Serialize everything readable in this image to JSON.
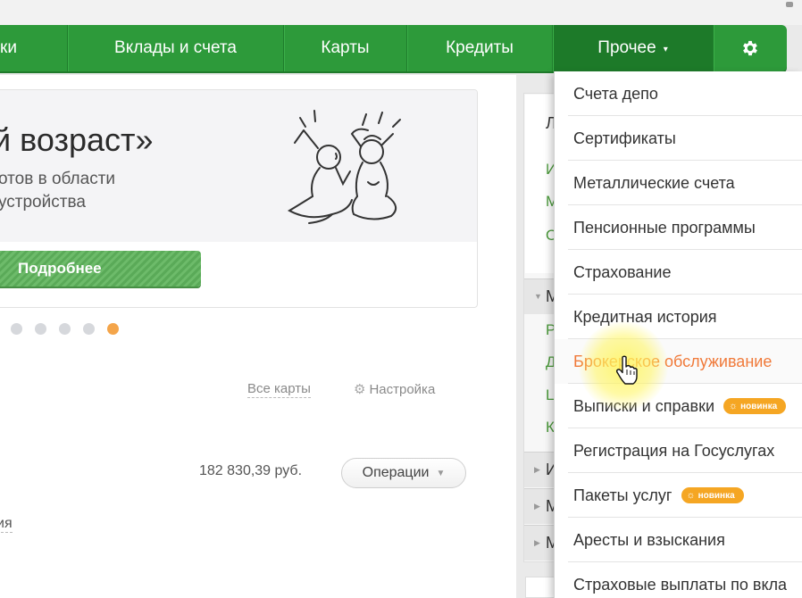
{
  "nav": {
    "items": [
      {
        "label": "ки"
      },
      {
        "label": "Вклады и счета"
      },
      {
        "label": "Карты"
      },
      {
        "label": "Кредиты"
      },
      {
        "label": "Прочее",
        "caret": "▾"
      }
    ],
    "settings_icon": "gear-icon",
    "colors": {
      "nav_bg": "#2d9a3a",
      "nav_active": "#1d7a29"
    }
  },
  "banner": {
    "title": "й возраст»",
    "text_line1": "отов в области",
    "text_line2": "устройства",
    "button_label": "Подробнее",
    "carousel": {
      "dot_count": 5,
      "active_index": 4
    }
  },
  "cards": {
    "all_cards_link": "Все карты",
    "settings_link": "Настройка",
    "amount": "182 830,39 руб.",
    "operations_button": "Операции",
    "partial_text": "ия"
  },
  "right_column": {
    "letters": [
      "Л",
      "И",
      "М",
      "О",
      "М",
      "Р",
      "Д",
      "Ц",
      "К",
      "И",
      "М",
      "М"
    ]
  },
  "dropdown": {
    "items": [
      {
        "label": "Счета депо"
      },
      {
        "label": "Сертификаты"
      },
      {
        "label": "Металлические счета"
      },
      {
        "label": "Пенсионные программы"
      },
      {
        "label": "Страхование"
      },
      {
        "label": "Кредитная история"
      },
      {
        "label": "Брокерское обслуживание",
        "active": true
      },
      {
        "label": "Выписки и справки",
        "badge": "новинка"
      },
      {
        "label": "Регистрация на Госуслугах"
      },
      {
        "label": "Пакеты услуг",
        "badge": "новинка"
      },
      {
        "label": "Аресты и взыскания"
      },
      {
        "label": "Страховые выплаты по вкла"
      }
    ],
    "colors": {
      "active_text": "#f07a3a",
      "badge_bg": "#f5a623"
    }
  }
}
